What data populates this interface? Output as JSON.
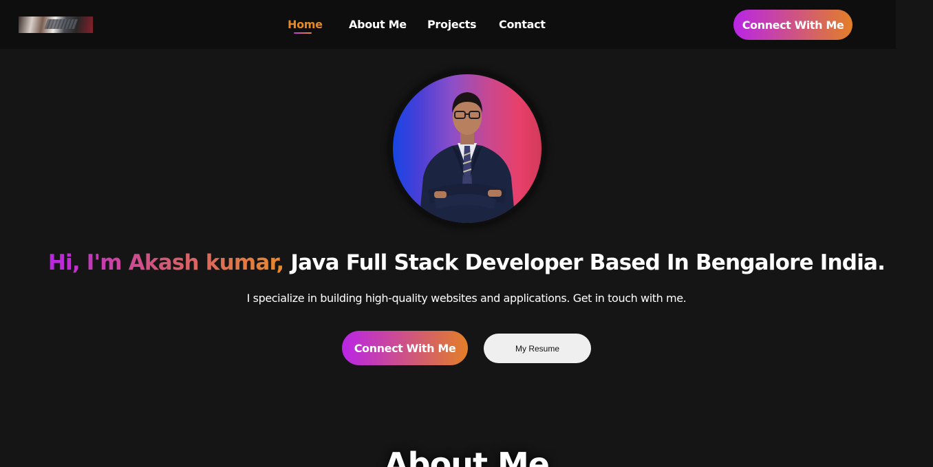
{
  "navbar": {
    "logo": "logo-image",
    "links": [
      {
        "label": "Home",
        "active": true
      },
      {
        "label": "About Me",
        "active": false
      },
      {
        "label": "Projects",
        "active": false
      },
      {
        "label": "Contact",
        "active": false
      }
    ],
    "cta_label": "Connect With Me"
  },
  "hero": {
    "avatar": "profile-photo",
    "title_highlight": "Hi, I'm Akash kumar,",
    "title_rest": " Java Full Stack Developer Based In Bengalore India.",
    "subtitle": "I specialize in building high-quality websites and applications. Get in touch with me.",
    "cta_label": "Connect With Me",
    "resume_label": "My Resume"
  },
  "about": {
    "title": "About Me"
  },
  "colors": {
    "background": "#161515",
    "navbar": "#0f0e0e",
    "gradient_start": "#b925e6",
    "gradient_end": "#e27f27",
    "active_link": "#e68a1f"
  }
}
